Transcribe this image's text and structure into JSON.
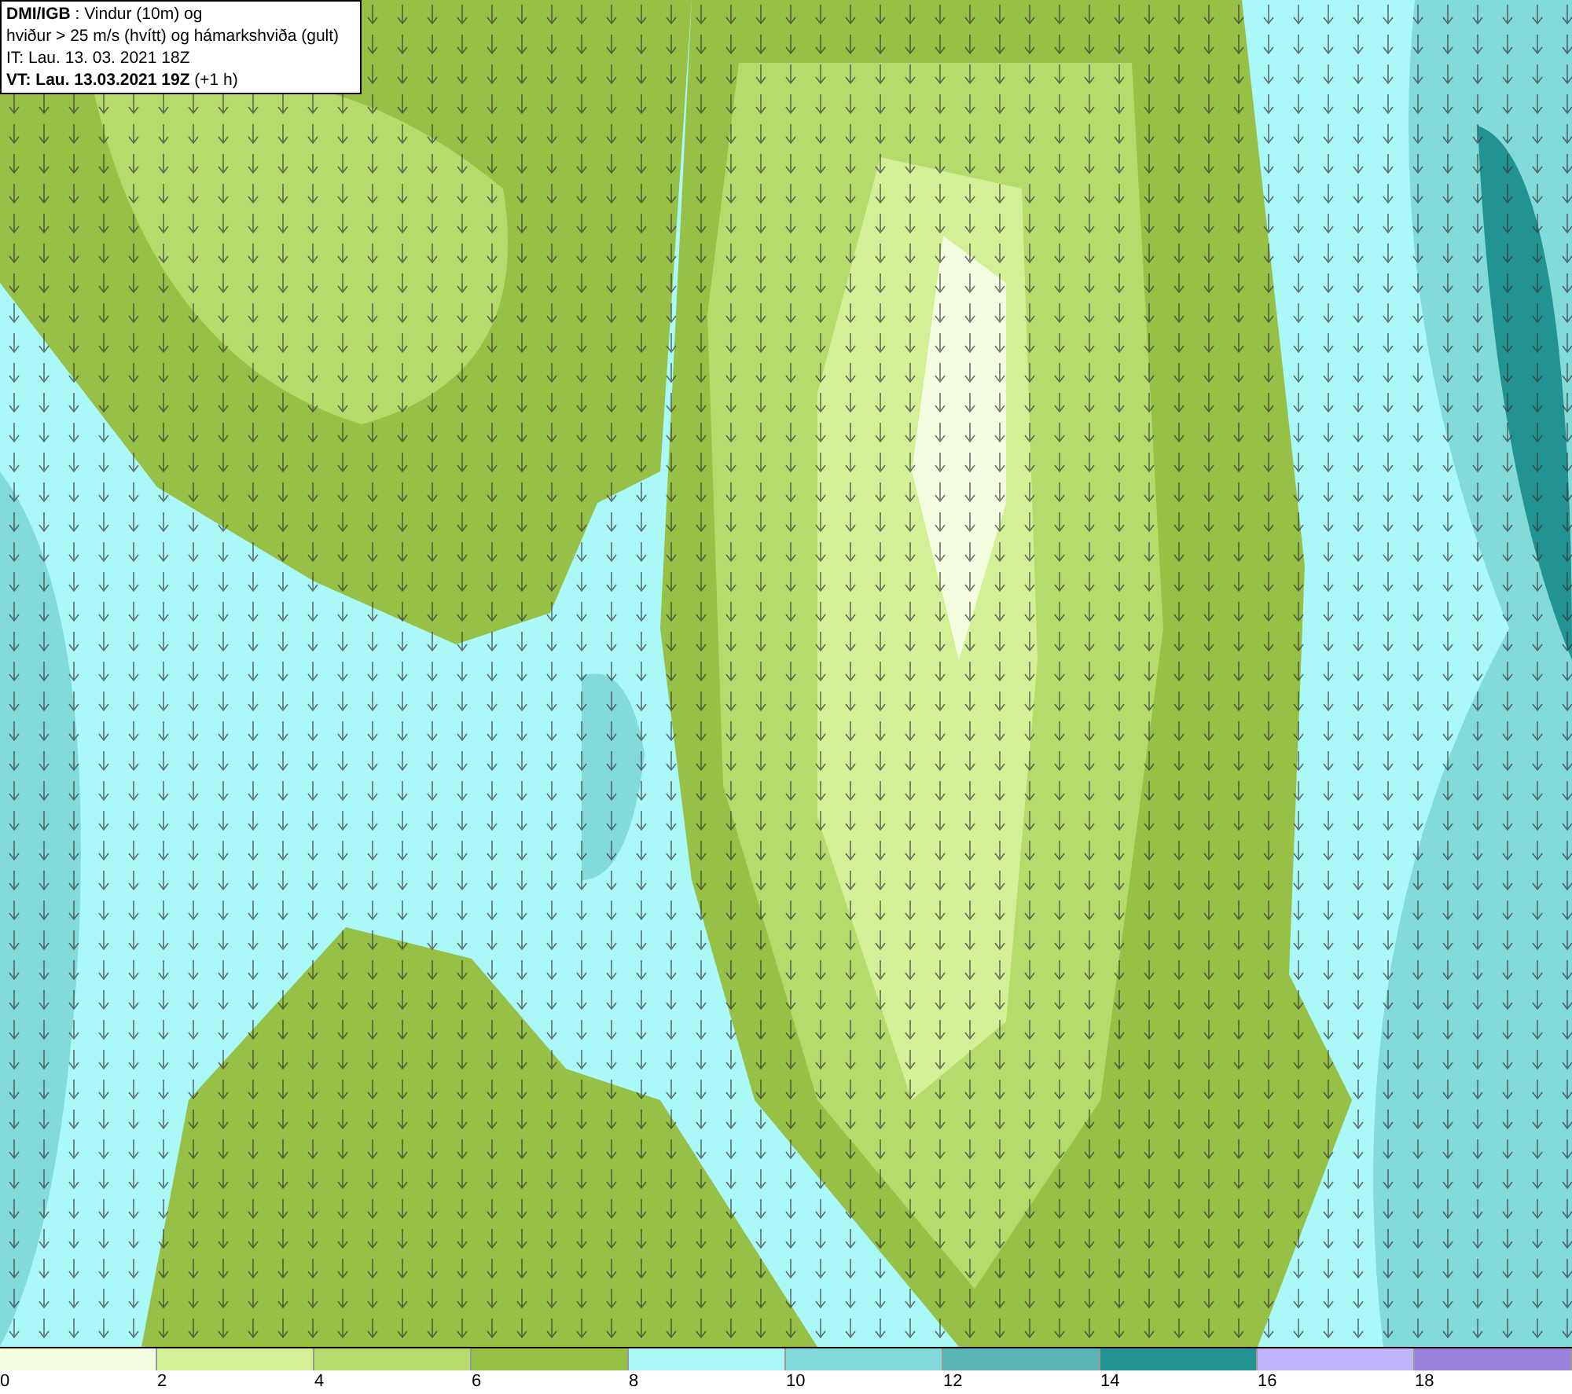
{
  "header": {
    "lines": [
      "**DMI/IGB** : Vindur (10m) og",
      "hviður > 25 m/s (hvítt) og hámarkshviða (gult)",
      "IT: Lau. 13. 03. 2021 18Z",
      "**VT: Lau. 13.03.2021 19Z** (+1 h)"
    ]
  },
  "legend": {
    "bins": [
      {
        "color": "#f4fde0"
      },
      {
        "color": "#d4ef96"
      },
      {
        "color": "#b6da6c"
      },
      {
        "color": "#97c046"
      },
      {
        "color": "#aaf8f8"
      },
      {
        "color": "#82dada"
      },
      {
        "color": "#5ab5b5"
      },
      {
        "color": "#239292"
      },
      {
        "color": "#c0b4fa"
      },
      {
        "color": "#9a83dc"
      }
    ],
    "labels": [
      "0",
      "2",
      "4",
      "6",
      "8",
      "10",
      "12",
      "14",
      "16",
      "18"
    ]
  }
}
